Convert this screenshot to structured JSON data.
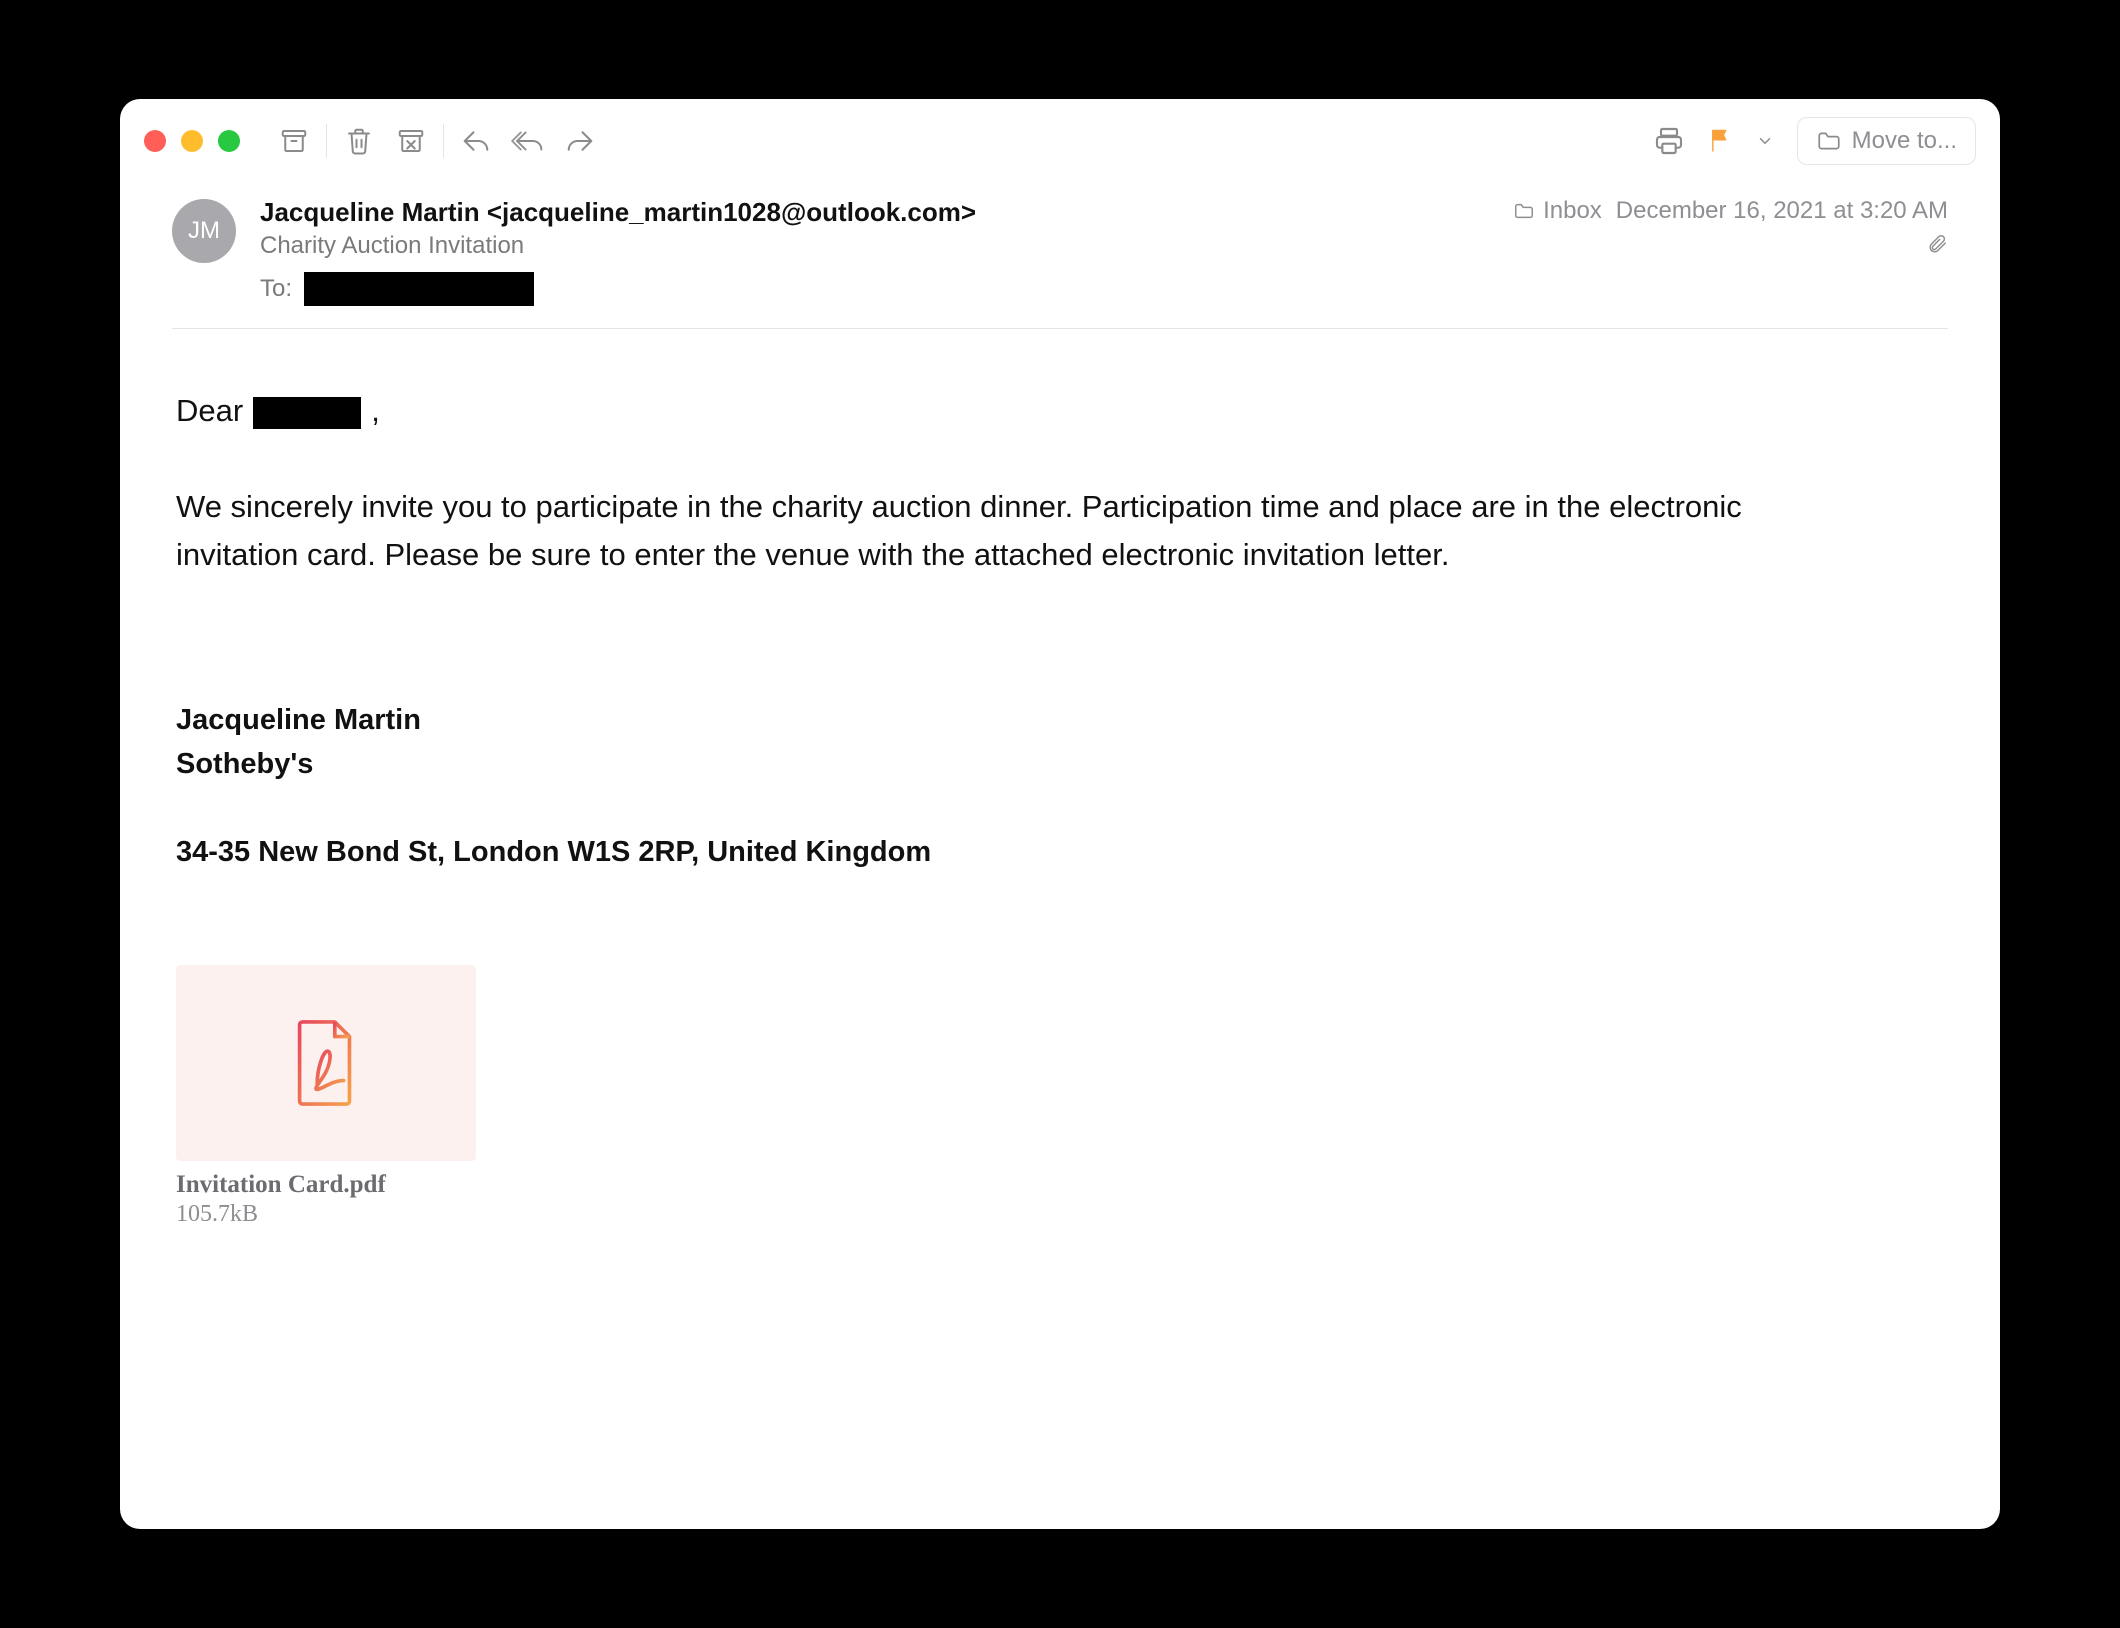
{
  "toolbar": {
    "move_to_label": "Move to..."
  },
  "header": {
    "avatar_initials": "JM",
    "from": "Jacqueline Martin <jacqueline_martin1028@outlook.com>",
    "subject": "Charity Auction Invitation",
    "to_label": "To:",
    "to_value_redacted": true,
    "folder_name": "Inbox",
    "datetime": "December 16, 2021 at 3:20 AM"
  },
  "body": {
    "greeting_prefix": "Dear ",
    "greeting_name_redacted": true,
    "greeting_suffix": ",",
    "paragraph": "We sincerely invite you to participate in the charity auction dinner. Participation time and place are in the electronic invitation card. Please be sure to enter the venue with the attached electronic invitation letter.",
    "signature_name": "Jacqueline Martin",
    "signature_company": "Sotheby's",
    "signature_address": "34-35 New Bond St, London W1S 2RP, United Kingdom"
  },
  "attachment": {
    "filename": "Invitation Card.pdf",
    "size": "105.7kB"
  }
}
